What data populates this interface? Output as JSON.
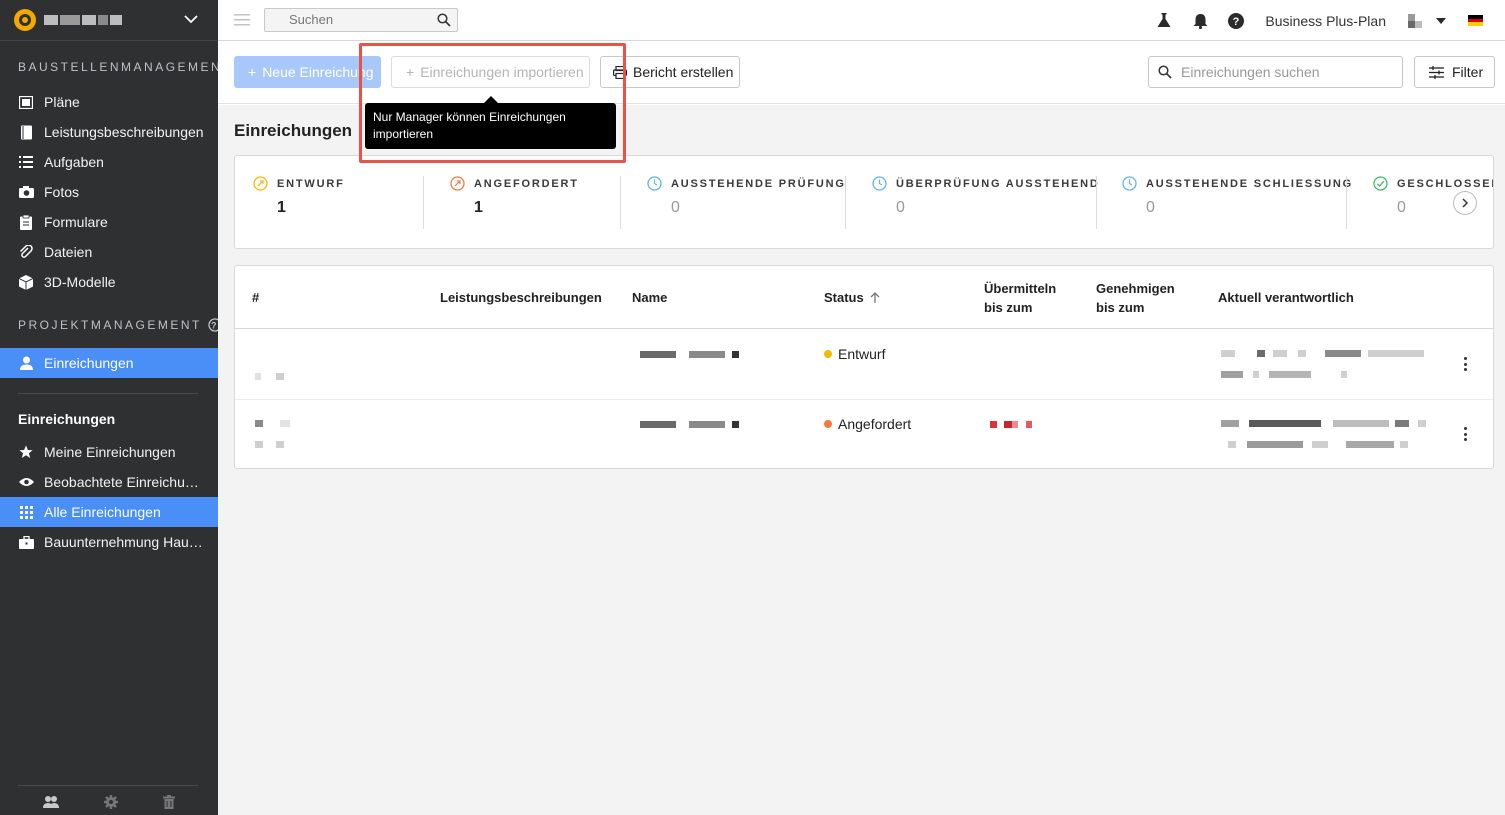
{
  "sidebar": {
    "section1": "BAUSTELLENMANAGEMENT",
    "items1": [
      {
        "label": "Pläne",
        "icon": "map-icon"
      },
      {
        "label": "Leistungsbeschreibungen",
        "icon": "book-icon"
      },
      {
        "label": "Aufgaben",
        "icon": "list-icon"
      },
      {
        "label": "Fotos",
        "icon": "camera-icon"
      },
      {
        "label": "Formulare",
        "icon": "clipboard-icon"
      },
      {
        "label": "Dateien",
        "icon": "paperclip-icon"
      },
      {
        "label": "3D-Modelle",
        "icon": "cube-icon"
      }
    ],
    "section2": "PROJEKTMANAGEMENT",
    "active_item": "Einreichungen",
    "heading": "Einreichungen",
    "items2": [
      {
        "label": "Meine Einreichungen",
        "icon": "star-icon"
      },
      {
        "label": "Beobachtete Einreichung...",
        "icon": "eye-icon"
      },
      {
        "label": "Alle Einreichungen",
        "icon": "grid-icon"
      },
      {
        "label": "Bauunternehmung Hausb...",
        "icon": "briefcase-icon"
      }
    ]
  },
  "topbar": {
    "search_placeholder": "Suchen",
    "plan": "Business Plus-Plan"
  },
  "toolbar": {
    "new_label": "Neue Einreichung",
    "import_label": "Einreichungen importieren",
    "report_label": "Bericht erstellen",
    "search_placeholder": "Einreichungen suchen",
    "filter_label": "Filter"
  },
  "tooltip": {
    "text": "Nur Manager können Einreichungen importieren"
  },
  "page": {
    "title": "Einreichungen"
  },
  "stats": [
    {
      "label": "ENTWURF",
      "value": "1",
      "color": "#f2b90c"
    },
    {
      "label": "ANGEFORDERT",
      "value": "1",
      "color": "#ef7a3a"
    },
    {
      "label": "AUSSTEHENDE PRÜFUNG",
      "value": "0",
      "color": "#62b5e5"
    },
    {
      "label": "ÜBERPRÜFUNG AUSSTEHEND",
      "value": "0",
      "color": "#62b5e5"
    },
    {
      "label": "AUSSTEHENDE SCHLIESSUNG",
      "value": "0",
      "color": "#62b5e5"
    },
    {
      "label": "GESCHLOSSEN",
      "value": "0",
      "color": "#3dbb6c"
    }
  ],
  "table": {
    "headers": {
      "num": "#",
      "specs": "Leistungsbeschreibungen",
      "name": "Name",
      "status": "Status",
      "submit_line1": "Übermitteln",
      "submit_line2": "bis zum",
      "approve_line1": "Genehmigen",
      "approve_line2": "bis zum",
      "responsible": "Aktuell verantwortlich"
    },
    "rows": [
      {
        "status": "Entwurf",
        "status_color": "#f2b90c"
      },
      {
        "status": "Angefordert",
        "status_color": "#ef7a3a"
      }
    ]
  },
  "colors": {
    "accent": "#4a8ef7",
    "sidebar_bg": "#2f3032",
    "highlight": "#e8524a"
  }
}
